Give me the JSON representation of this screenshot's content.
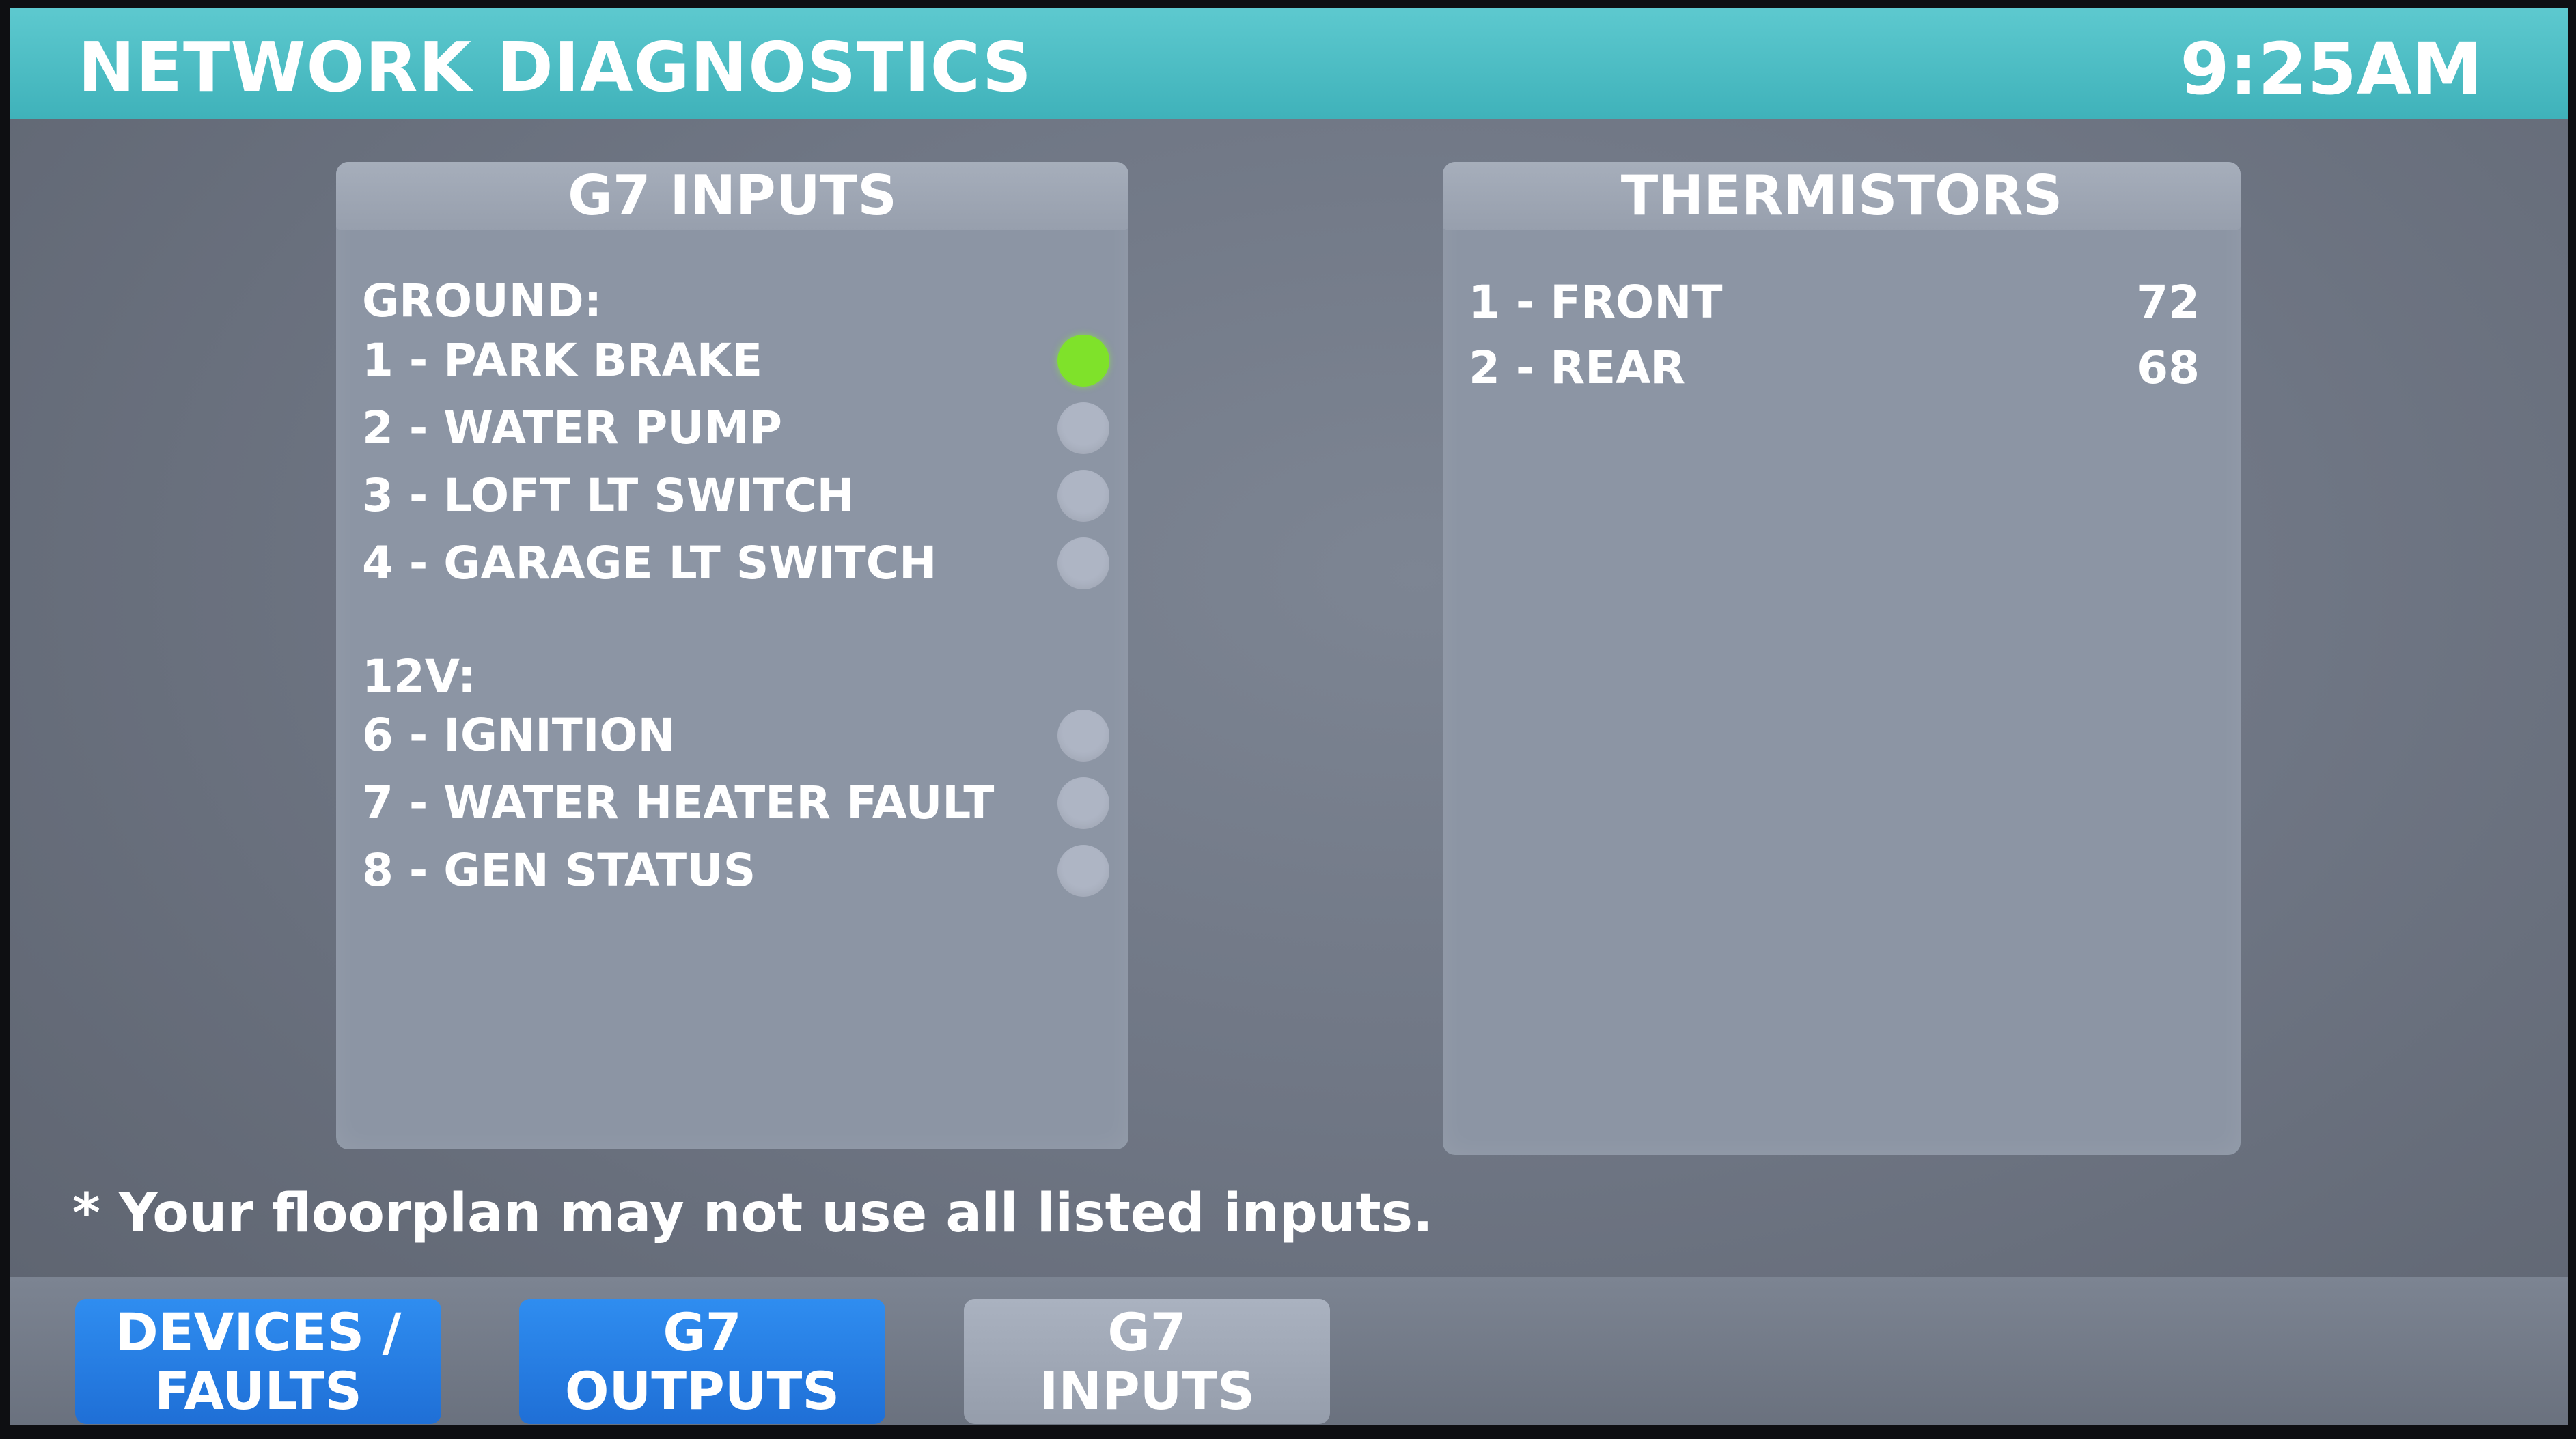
{
  "header": {
    "title": "NETWORK DIAGNOSTICS",
    "time": "9:25AM"
  },
  "inputs_panel": {
    "title": "G7 INPUTS",
    "ground_label": "GROUND:",
    "ground": [
      {
        "label": "1 - PARK BRAKE",
        "active": true
      },
      {
        "label": "2 - WATER PUMP",
        "active": false
      },
      {
        "label": "3 - LOFT LT SWITCH",
        "active": false
      },
      {
        "label": "4 - GARAGE LT SWITCH",
        "active": false
      }
    ],
    "v12_label": "12V:",
    "v12": [
      {
        "label": "6 - IGNITION",
        "active": false
      },
      {
        "label": "7 - WATER HEATER FAULT",
        "active": false
      },
      {
        "label": "8 - GEN STATUS",
        "active": false
      }
    ],
    "colors": {
      "active": "#7fe22a",
      "inactive": "#aeb5c4"
    }
  },
  "thermistors_panel": {
    "title": "THERMISTORS",
    "items": [
      {
        "label": "1 - FRONT",
        "value": "72"
      },
      {
        "label": "2 - REAR",
        "value": "68"
      }
    ]
  },
  "note": "* Your floorplan may not use all listed inputs.",
  "tabs": [
    {
      "line1": "DEVICES /",
      "line2": "FAULTS",
      "selected": false
    },
    {
      "line1": "G7",
      "line2": "OUTPUTS",
      "selected": false
    },
    {
      "line1": "G7",
      "line2": "INPUTS",
      "selected": true
    }
  ],
  "theme": {
    "header_color": "#46b8bf",
    "tab_color": "#2a84ea",
    "selected_tab_color": "#a0a8b6"
  }
}
